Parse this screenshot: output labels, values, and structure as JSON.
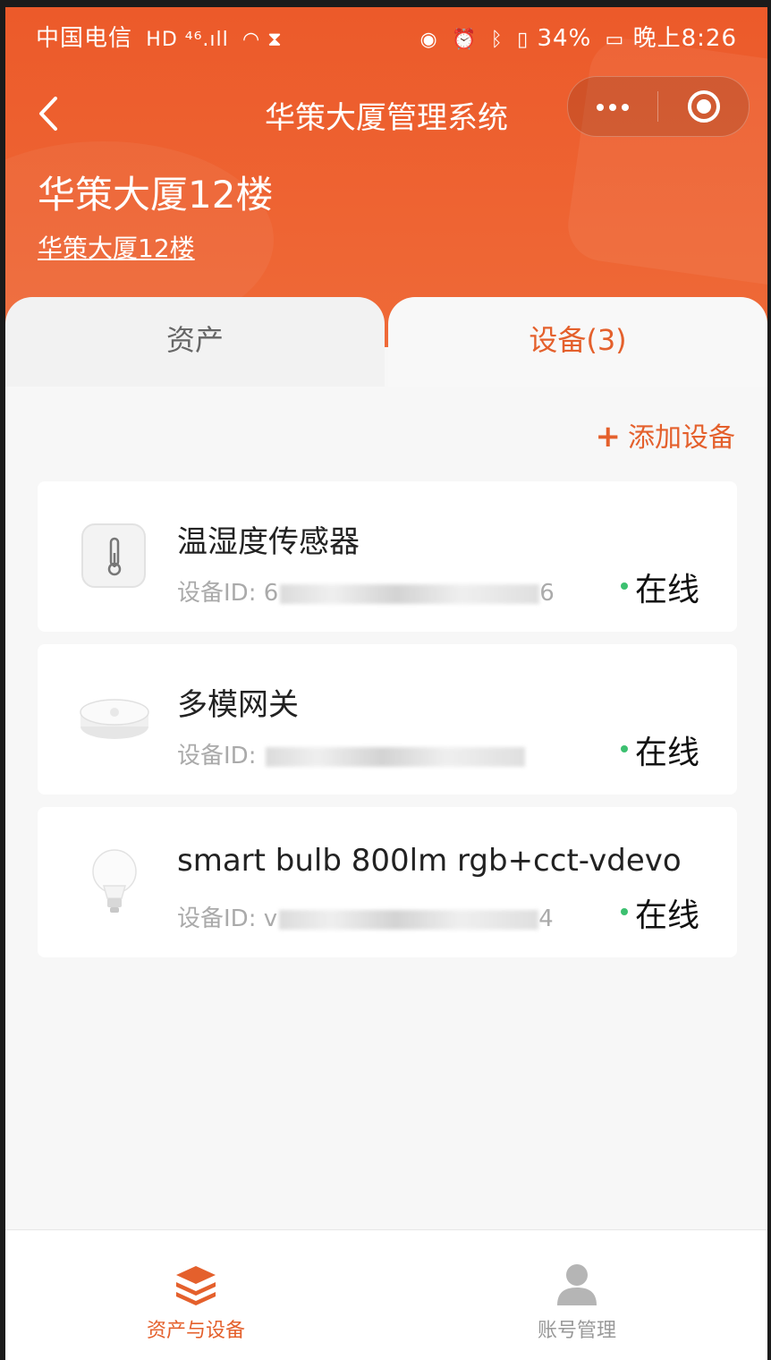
{
  "status_bar": {
    "carrier": "中国电信",
    "network_badges": "HD ⁴⁶.ıll",
    "battery": "34%",
    "time": "晚上8:26"
  },
  "header": {
    "back_icon": "chevron-left-icon",
    "title": "华策大厦管理系统",
    "more_icon": "more-dots-icon",
    "close_icon": "target-circle-icon",
    "building_title": "华策大厦12楼",
    "building_sub": "华策大厦12楼"
  },
  "tabs": [
    {
      "label": "资产",
      "active": false
    },
    {
      "label": "设备(3)",
      "active": true
    }
  ],
  "actions": {
    "add_device_icon": "plus-icon",
    "add_device_label": "添加设备"
  },
  "devices": [
    {
      "name": "温湿度传感器",
      "id_label": "设备ID:",
      "id_value": "6",
      "id_suffix": "6",
      "status": "在线",
      "icon": "thermometer-sensor-icon"
    },
    {
      "name": "多模网关",
      "id_label": "设备ID:",
      "id_value": "",
      "id_suffix": "",
      "status": "在线",
      "icon": "gateway-hub-icon"
    },
    {
      "name": "smart bulb 800lm rgb+cct-vdevo",
      "id_label": "设备ID:",
      "id_value": "v",
      "id_suffix": "4",
      "status": "在线",
      "icon": "light-bulb-icon"
    }
  ],
  "bottom_nav": [
    {
      "label": "资产与设备",
      "icon": "layers-icon",
      "active": true
    },
    {
      "label": "账号管理",
      "icon": "user-icon",
      "active": false
    }
  ],
  "colors": {
    "accent": "#e4602c",
    "header_bg": "#ec5a2a",
    "online_dot": "#3cc070"
  }
}
